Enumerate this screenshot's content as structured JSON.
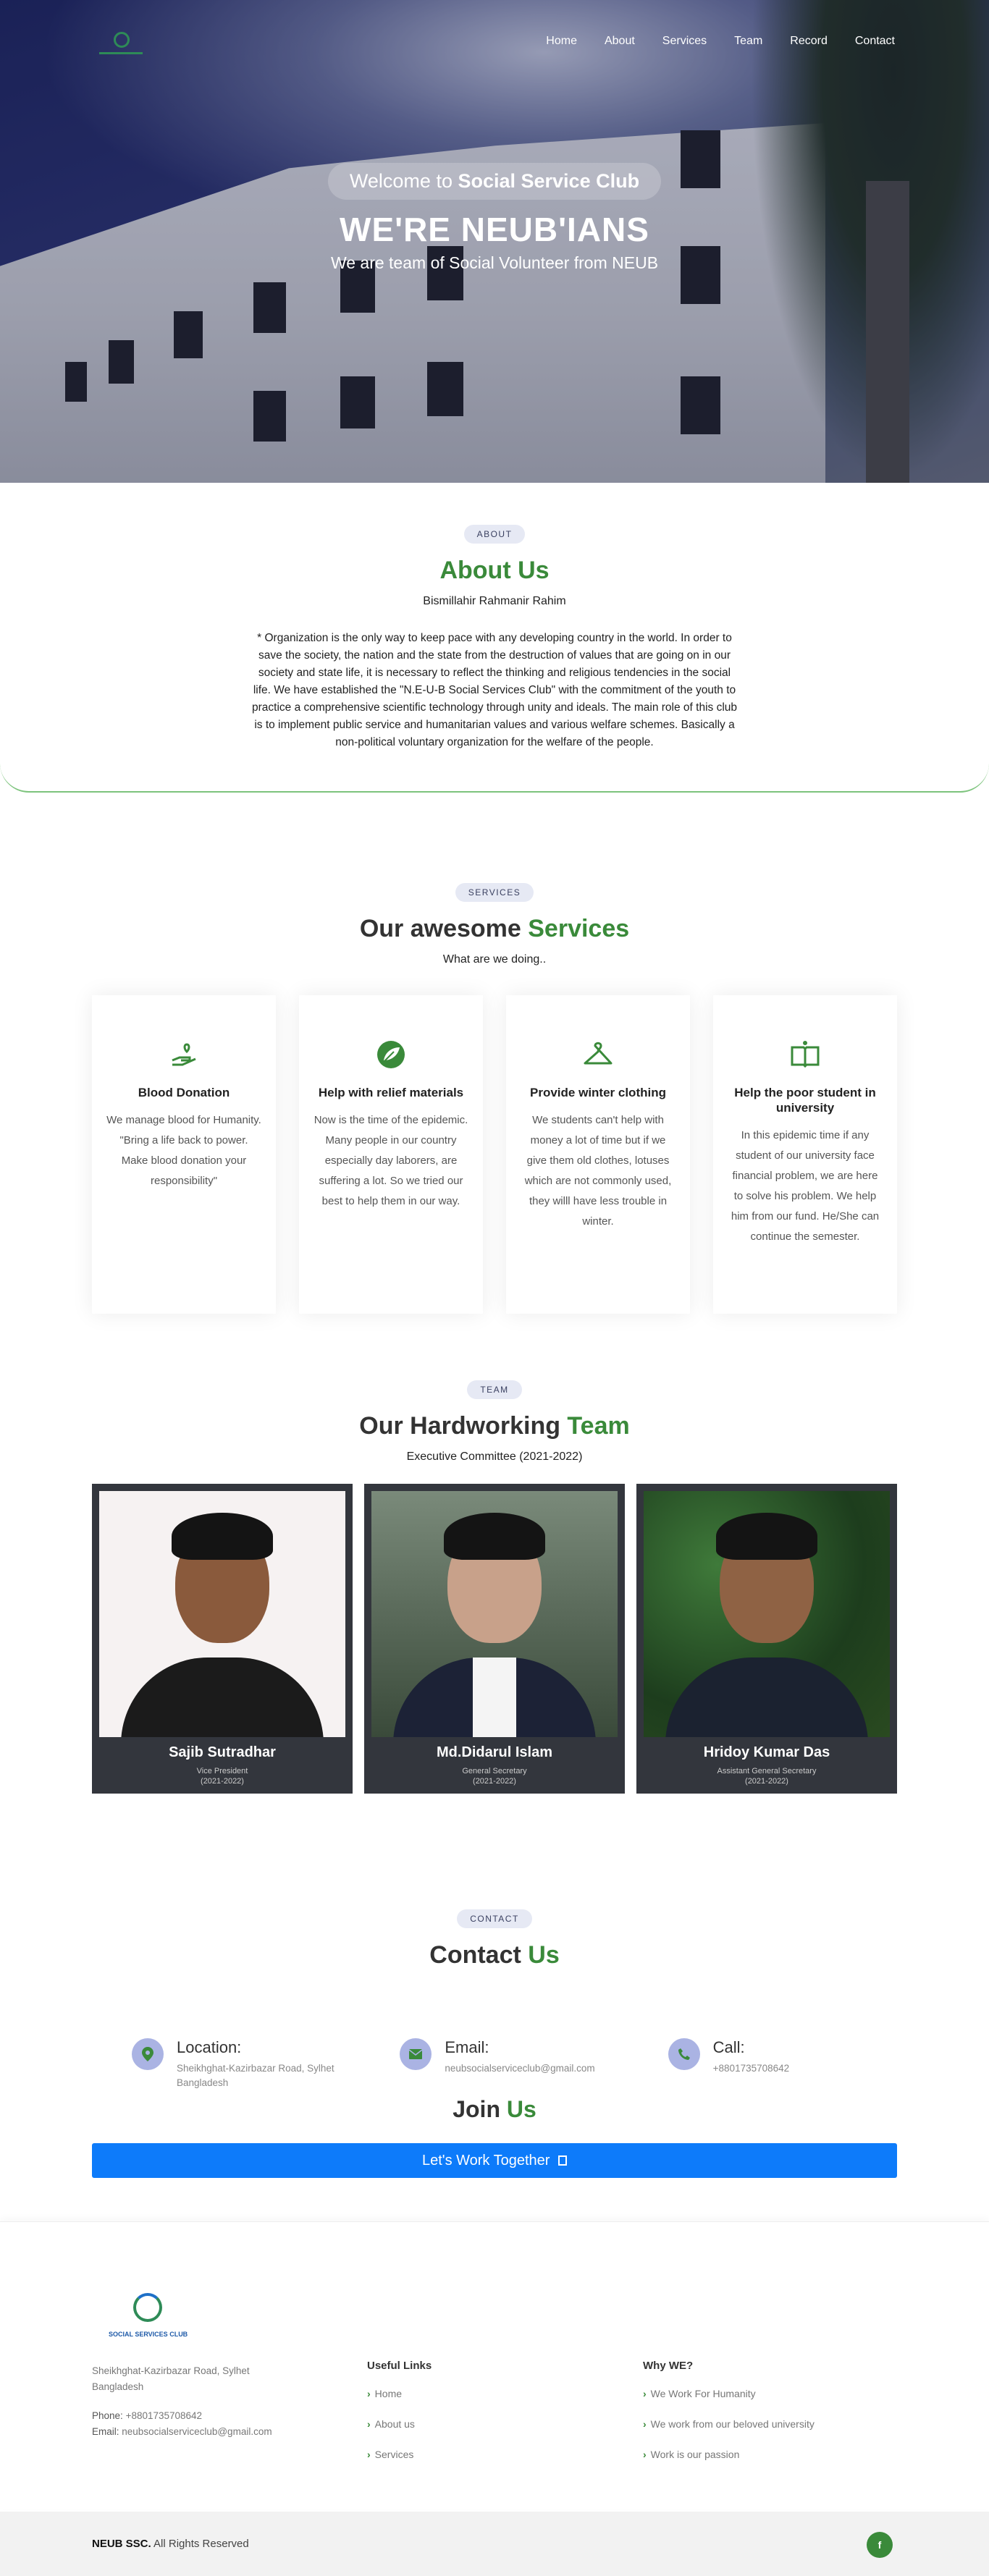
{
  "nav": {
    "items": [
      "Home",
      "About",
      "Services",
      "Team",
      "Record",
      "Contact"
    ]
  },
  "hero": {
    "welcome_prefix": "Welcome to ",
    "welcome_bold": "Social Service Club",
    "title": "WE'RE NEUB'IANS",
    "subtitle": "We are team of Social Volunteer from NEUB"
  },
  "about": {
    "badge": "ABOUT",
    "title": "About Us",
    "bismillah": "Bismillahir Rahmanir Rahim",
    "paragraph": "* Organization is the only way to keep pace with any developing country in the world. In order to save the society, the nation and the state from the destruction of values that are going on in our society and state life, it is necessary to reflect the thinking and religious tendencies in the social life. We have established the \"N.E-U-B Social Services Club\" with the commitment of the youth to practice a comprehensive scientific technology through unity and ideals. The main role of this club is to implement public service and humanitarian values and various welfare schemes. Basically a non-political voluntary organization for the welfare of the people."
  },
  "services": {
    "badge": "SERVICES",
    "title_prefix": "Our awesome ",
    "title_green": "Services",
    "subtitle": "What are we doing..",
    "cards": [
      {
        "title": "Blood Donation",
        "text": "We manage blood for Humanity. \"Bring a life back to power. Make blood donation your responsibility\"",
        "icon": "hand-heart-icon"
      },
      {
        "title": "Help with relief materials",
        "text": "Now is the time of the epidemic. Many people in our country especially day laborers, are suffering a lot. So we tried our best to help them in our way.",
        "icon": "leaf-icon"
      },
      {
        "title": "Provide winter clothing",
        "text": "We students can't help with money a lot of time but if we give them old clothes, lotuses which are not commonly used, they willl have less trouble in winter.",
        "icon": "hanger-icon"
      },
      {
        "title": "Help the poor student in university",
        "text": "In this epidemic time if any student of our university face financial problem, we are here to solve his problem. We help him from our fund. He/She can continue the semester.",
        "icon": "book-icon"
      }
    ]
  },
  "team": {
    "badge": "TEAM",
    "title_prefix": "Our Hardworking ",
    "title_green": "Team",
    "subtitle": "Executive Committee (2021-2022)",
    "members": [
      {
        "name": "Sajib Sutradhar",
        "role": "Vice President",
        "year": "(2021-2022)"
      },
      {
        "name": "Md.Didarul Islam",
        "role": "General Secretary",
        "year": "(2021-2022)"
      },
      {
        "name": "Hridoy Kumar Das",
        "role": "Assistant General Secretary",
        "year": "(2021-2022)"
      }
    ]
  },
  "contact": {
    "badge": "CONTACT",
    "title_prefix": "Contact ",
    "title_green": "Us",
    "location_label": "Location:",
    "location_value": "Sheikhghat-Kazirbazar Road, Sylhet Bangladesh",
    "email_label": "Email:",
    "email_value": "neubsocialserviceclub@gmail.com",
    "call_label": "Call:",
    "call_value": "+8801735708642",
    "join_prefix": "Join ",
    "join_green": "Us",
    "work_button": "Let's Work Together"
  },
  "footer": {
    "logo_text": "SOCIAL SERVICES CLUB",
    "address": "Sheikhghat-Kazirbazar Road, Sylhet Bangladesh",
    "phone_label": "Phone:",
    "phone": "+8801735708642",
    "email_label": "Email:",
    "email": "neubsocialserviceclub@gmail.com",
    "useful_links_title": "Useful Links",
    "useful_links": [
      "Home",
      "About us",
      "Services"
    ],
    "why_title": "Why WE?",
    "why_items": [
      "We Work For Humanity",
      "We work from our beloved university",
      "Work is our passion"
    ],
    "copyright_bold": "NEUB SSC.",
    "copyright_rest": " All Rights Reserved",
    "facebook_glyph": "f"
  },
  "colors": {
    "accent_green": "#3a8a3a",
    "button_blue": "#0d7bfa",
    "team_card_bg": "#33363d"
  }
}
